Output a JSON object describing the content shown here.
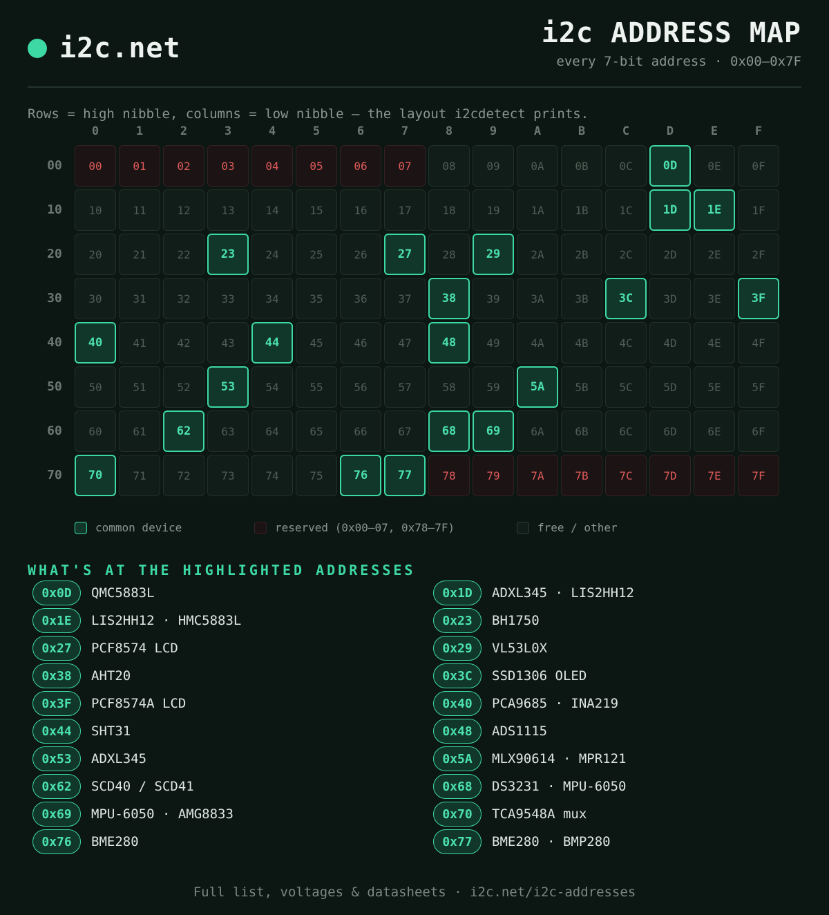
{
  "header": {
    "logo_text": "i2c.net",
    "title": "i2c ADDRESS MAP",
    "subtitle": "every 7-bit address · 0x00–0x7F"
  },
  "caption": "Rows = high nibble, columns = low nibble — the layout i2cdetect prints.",
  "grid": {
    "column_labels": [
      "0",
      "1",
      "2",
      "3",
      "4",
      "5",
      "6",
      "7",
      "8",
      "9",
      "A",
      "B",
      "C",
      "D",
      "E",
      "F"
    ],
    "row_labels": [
      "00",
      "10",
      "20",
      "30",
      "40",
      "50",
      "60",
      "70"
    ],
    "common_addresses": [
      "0D",
      "1D",
      "1E",
      "23",
      "27",
      "29",
      "38",
      "3C",
      "3F",
      "40",
      "44",
      "48",
      "53",
      "5A",
      "62",
      "68",
      "69",
      "70",
      "76",
      "77"
    ],
    "reserved_addresses": [
      "00",
      "01",
      "02",
      "03",
      "04",
      "05",
      "06",
      "07",
      "78",
      "79",
      "7A",
      "7B",
      "7C",
      "7D",
      "7E",
      "7F"
    ],
    "colors": {
      "common": "#3dd9a4",
      "reserved": "#e05a5a",
      "free": "#4f5d56"
    }
  },
  "legend": {
    "common": "common device",
    "reserved": "reserved (0x00–07, 0x78–7F)",
    "free": "free / other"
  },
  "devices_title": "WHAT'S AT THE HIGHLIGHTED ADDRESSES",
  "devices": [
    {
      "addr": "0x0D",
      "name": "QMC5883L"
    },
    {
      "addr": "0x1D",
      "name": "ADXL345 · LIS2HH12"
    },
    {
      "addr": "0x1E",
      "name": "LIS2HH12 · HMC5883L"
    },
    {
      "addr": "0x23",
      "name": "BH1750"
    },
    {
      "addr": "0x27",
      "name": "PCF8574 LCD"
    },
    {
      "addr": "0x29",
      "name": "VL53L0X"
    },
    {
      "addr": "0x38",
      "name": "AHT20"
    },
    {
      "addr": "0x3C",
      "name": "SSD1306 OLED"
    },
    {
      "addr": "0x3F",
      "name": "PCF8574A LCD"
    },
    {
      "addr": "0x40",
      "name": "PCA9685 · INA219"
    },
    {
      "addr": "0x44",
      "name": "SHT31"
    },
    {
      "addr": "0x48",
      "name": "ADS1115"
    },
    {
      "addr": "0x53",
      "name": "ADXL345"
    },
    {
      "addr": "0x5A",
      "name": "MLX90614 · MPR121"
    },
    {
      "addr": "0x62",
      "name": "SCD40 / SCD41"
    },
    {
      "addr": "0x68",
      "name": "DS3231 · MPU-6050"
    },
    {
      "addr": "0x69",
      "name": "MPU-6050 · AMG8833"
    },
    {
      "addr": "0x70",
      "name": "TCA9548A mux"
    },
    {
      "addr": "0x76",
      "name": "BME280"
    },
    {
      "addr": "0x77",
      "name": "BME280 · BMP280"
    }
  ],
  "footer": "Full list, voltages & datasheets · i2c.net/i2c-addresses"
}
